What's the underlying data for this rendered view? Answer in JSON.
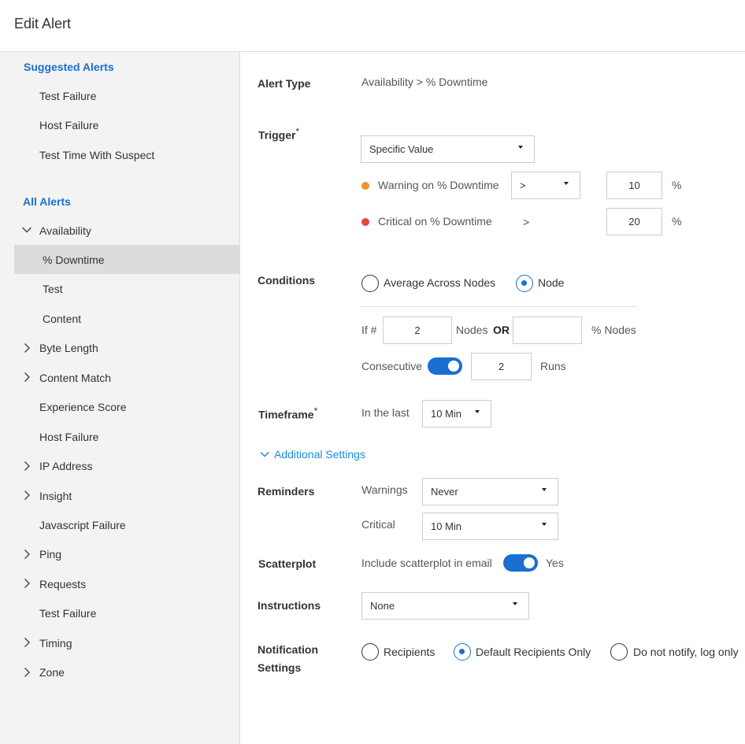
{
  "header": {
    "title": "Edit Alert"
  },
  "sidebar": {
    "suggested_heading": "Suggested Alerts",
    "suggested": [
      "Test Failure",
      "Host Failure",
      "Test Time With Suspect"
    ],
    "all_heading": "All Alerts",
    "all": [
      {
        "label": "Availability",
        "chevron": "down"
      },
      {
        "label": "% Downtime",
        "chevron": "",
        "active": true,
        "child": true
      },
      {
        "label": "Test",
        "chevron": "",
        "child": true
      },
      {
        "label": "Content",
        "chevron": "",
        "child": true
      },
      {
        "label": "Byte Length",
        "chevron": "right"
      },
      {
        "label": "Content Match",
        "chevron": "right"
      },
      {
        "label": "Experience Score",
        "chevron": ""
      },
      {
        "label": "Host Failure",
        "chevron": ""
      },
      {
        "label": "IP Address",
        "chevron": "right"
      },
      {
        "label": "Insight",
        "chevron": "right"
      },
      {
        "label": "Javascript Failure",
        "chevron": ""
      },
      {
        "label": "Ping",
        "chevron": "right"
      },
      {
        "label": "Requests",
        "chevron": "right"
      },
      {
        "label": "Test Failure",
        "chevron": ""
      },
      {
        "label": "Timing",
        "chevron": "right"
      },
      {
        "label": "Zone",
        "chevron": "right"
      }
    ]
  },
  "form": {
    "alert_type": {
      "label": "Alert Type",
      "value": "Availability > % Downtime"
    },
    "trigger": {
      "label": "Trigger",
      "required_mark": "*",
      "mode": "Specific Value",
      "warning": {
        "label": "Warning on % Downtime",
        "operator": ">",
        "value": "10",
        "unit": "%",
        "color": "#f0932b"
      },
      "critical": {
        "label": "Critical on % Downtime",
        "operator": ">",
        "value": "20",
        "unit": "%",
        "color": "#e84545"
      }
    },
    "conditions": {
      "label": "Conditions",
      "option_average": "Average Across Nodes",
      "option_node": "Node",
      "if_label": "If #",
      "nodes_value": "2",
      "nodes_label": "Nodes",
      "or_label": "OR",
      "percent_nodes_value": "",
      "percent_nodes_label": "% Nodes",
      "consecutive_label": "Consecutive",
      "runs_value": "2",
      "runs_label": "Runs"
    },
    "timeframe": {
      "label": "Timeframe",
      "required_mark": "*",
      "prefix": "In the last",
      "value": "10 Min"
    },
    "additional_settings": "Additional Settings",
    "reminders": {
      "label": "Reminders",
      "warnings_label": "Warnings",
      "warnings_value": "Never",
      "critical_label": "Critical",
      "critical_value": "10 Min"
    },
    "scatterplot": {
      "label": "Scatterplot",
      "text": "Include scatterplot in email",
      "toggle_label": "Yes"
    },
    "instructions": {
      "label": "Instructions",
      "value": "None"
    },
    "notification": {
      "label_line1": "Notification",
      "label_line2": "Settings",
      "option_recipients": "Recipients",
      "option_default": "Default Recipients Only",
      "option_none": "Do not notify, log only"
    }
  },
  "colors": {
    "accent": "#1a6fd0",
    "link": "#1a8be0"
  }
}
